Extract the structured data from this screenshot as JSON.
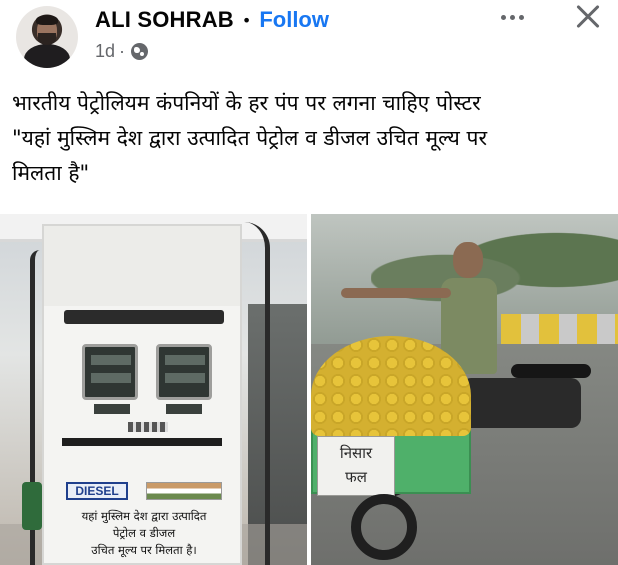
{
  "post": {
    "author": {
      "name": "ALI SOHRAB",
      "separator": "•",
      "follow_label": "Follow"
    },
    "meta": {
      "time": "1d",
      "separator": "·",
      "privacy_icon": "globe-icon"
    },
    "actions": {
      "more_icon": "more-options-icon",
      "close_icon": "close-icon"
    },
    "text": {
      "line1": "भारतीय पेट्रोलियम कंपनियों के हर पंप पर लगना चाहिए पोस्टर",
      "line2": "\"यहां मुस्लिम देश द्वारा उत्पादित पेट्रोल व डीजल उचित मूल्य पर",
      "line3": "मिलता है\""
    }
  },
  "images": {
    "left": {
      "diesel_label": "DIESEL",
      "poster_line1": "यहां मुस्लिम देश द्वारा उत्पादित",
      "poster_line2": "पेट्रोल व डीजल",
      "poster_line3": "उचित मूल्य पर मिलता है।"
    },
    "right": {
      "sign_line1": "निसार",
      "sign_line2": "फल"
    }
  },
  "colors": {
    "accent": "#1877f2",
    "text": "#050505",
    "secondary": "#65676b"
  }
}
